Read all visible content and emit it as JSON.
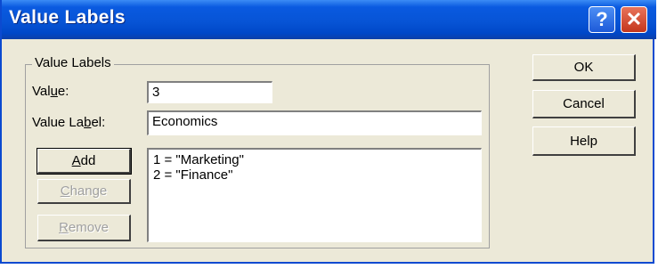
{
  "window": {
    "title": "Value Labels",
    "help_glyph": "?",
    "close_glyph": "✕"
  },
  "group": {
    "label": "Value Labels"
  },
  "value": {
    "label_pre": "Val",
    "label_u": "u",
    "label_post": "e:",
    "input": "3"
  },
  "value_label": {
    "label_pre": "Value La",
    "label_u": "b",
    "label_post": "el:",
    "input": "Economics"
  },
  "buttons": {
    "add_u": "A",
    "add_rest": "dd",
    "change_u": "C",
    "change_rest": "hange",
    "remove_u": "R",
    "remove_rest": "emove",
    "ok": "OK",
    "cancel": "Cancel",
    "help": "Help"
  },
  "list": {
    "items": [
      "1 = \"Marketing\"",
      "2 = \"Finance\""
    ]
  },
  "colors": {
    "title_bar": "#0754d6",
    "dialog_bg": "#ece9d8",
    "close_button": "#c4361c"
  }
}
